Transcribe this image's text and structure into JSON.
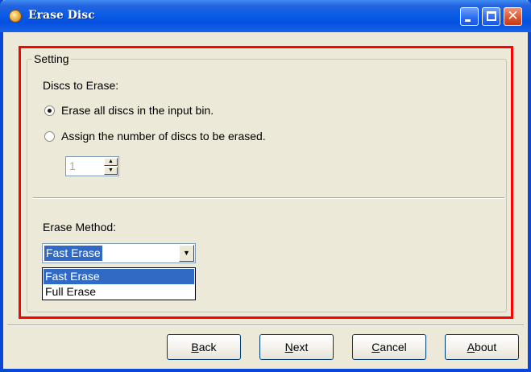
{
  "window": {
    "title": "Erase Disc",
    "icon": "disc-app-icon",
    "controls": [
      "minimize",
      "maximize",
      "close"
    ],
    "close_glyph": "✕"
  },
  "setting": {
    "group_label": "Setting",
    "discs_label": "Discs to Erase:",
    "option_all": "Erase all discs in the input bin.",
    "option_assign": "Assign the number of discs to be erased.",
    "selected_option": "all",
    "disc_count": "1",
    "erase_method_label": "Erase Method:",
    "erase_method_value": "Fast Erase",
    "erase_method_options": [
      "Fast Erase",
      "Full Erase"
    ]
  },
  "buttons": {
    "back": {
      "mnemonic": "B",
      "rest": "ack"
    },
    "next": {
      "mnemonic": "N",
      "rest": "ext"
    },
    "cancel": {
      "mnemonic": "C",
      "rest": "ancel"
    },
    "about": {
      "mnemonic": "A",
      "rest": "bout"
    }
  },
  "colors": {
    "titlebar": "#0a5de6",
    "highlight_frame": "#ff0000",
    "selection": "#316ac5",
    "window_bg": "#ece9d8"
  }
}
